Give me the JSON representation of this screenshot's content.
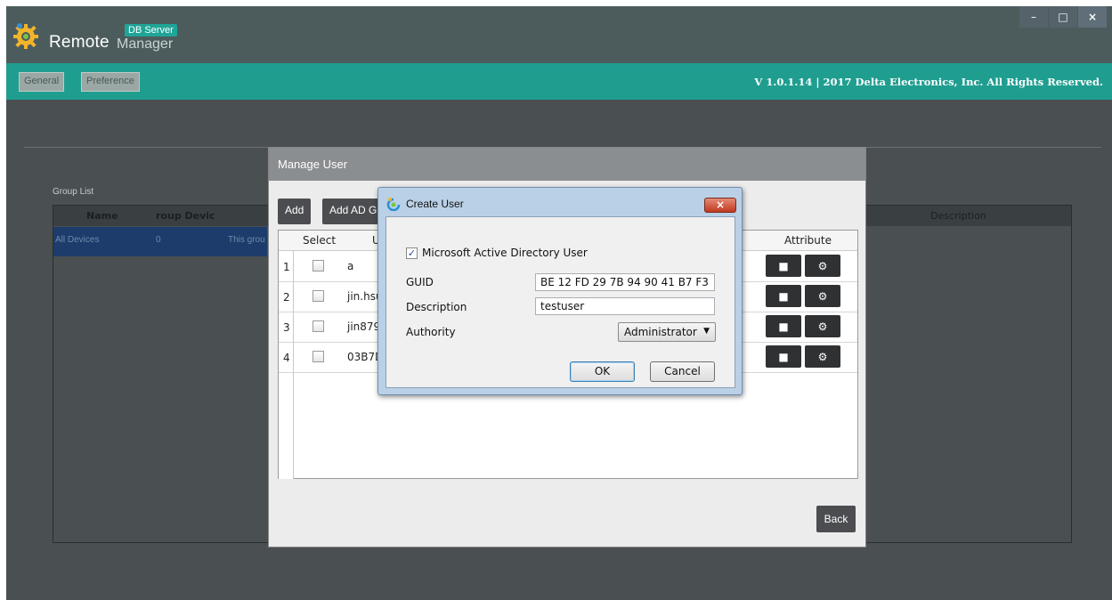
{
  "app": {
    "brand_badge": "DB Server",
    "brand_remote": "Remote",
    "brand_manager": "Manager",
    "copyright": "V 1.0.1.14  |  2017 Delta Electronics, Inc. All Rights Reserved.",
    "menu": {
      "general": "General",
      "preference": "Preference"
    },
    "window_controls": {
      "minimize": "–",
      "maximize": "□",
      "close": "×"
    }
  },
  "group_list": {
    "label": "Group List",
    "headers": [
      "Name",
      "roup Devic",
      "Description"
    ],
    "row": [
      "All Devices",
      "0",
      "This grou"
    ]
  },
  "manage_user": {
    "title": "Manage User",
    "add_label": "Add",
    "add_ad_label": "Add AD G",
    "headers": {
      "select": "Select",
      "user": "Us",
      "attribute": "Attribute"
    },
    "rows": [
      {
        "num": "1",
        "name": "a"
      },
      {
        "num": "2",
        "name": "jin.hsu"
      },
      {
        "num": "3",
        "name": "jin879"
      },
      {
        "num": "4",
        "name": "03B7D"
      }
    ],
    "back_label": "Back"
  },
  "create_user": {
    "title": "Create User",
    "close_label": "×",
    "ad_checkbox_label": "Microsoft Active Directory User",
    "ad_checked": true,
    "guid_label": "GUID",
    "guid_value": "BE 12 FD 29 7B 94 90 41 B7 F3",
    "description_label": "Description",
    "description_value": "testuser",
    "authority_label": "Authority",
    "authority_value": "Administrator",
    "ok_label": "OK",
    "cancel_label": "Cancel"
  },
  "colors": {
    "menubar": "#1f9e90",
    "titlebar": "#4c5c5c",
    "app_bg": "#4a4f52",
    "dialog_title": "#8b8e90",
    "dark_button": "#4b4d50"
  }
}
